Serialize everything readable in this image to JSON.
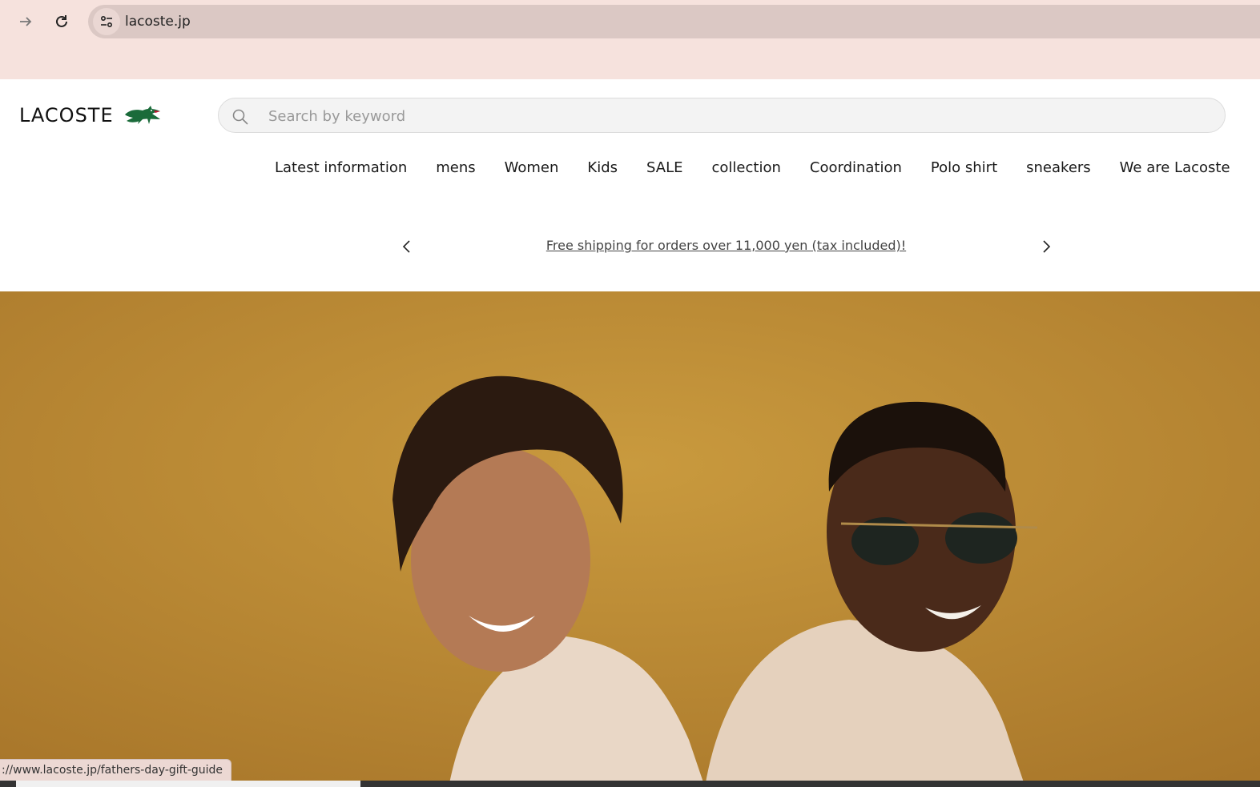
{
  "browser": {
    "url": "lacoste.jp",
    "status_url": "://www.lacoste.jp/fathers-day-gift-guide"
  },
  "header": {
    "logo_text": "LACOSTE",
    "search_placeholder": "Search by keyword"
  },
  "nav": {
    "items": [
      "Latest information",
      "mens",
      "Women",
      "Kids",
      "SALE",
      "collection",
      "Coordination",
      "Polo shirt",
      "sneakers",
      "We are Lacoste"
    ]
  },
  "promo": {
    "message": "Free shipping for orders over 11,000 yen (tax included)!"
  },
  "colors": {
    "chrome_bg": "#f6e2dd",
    "hero_bg": "#bb8a2e",
    "croc_green": "#1a6b3a"
  }
}
